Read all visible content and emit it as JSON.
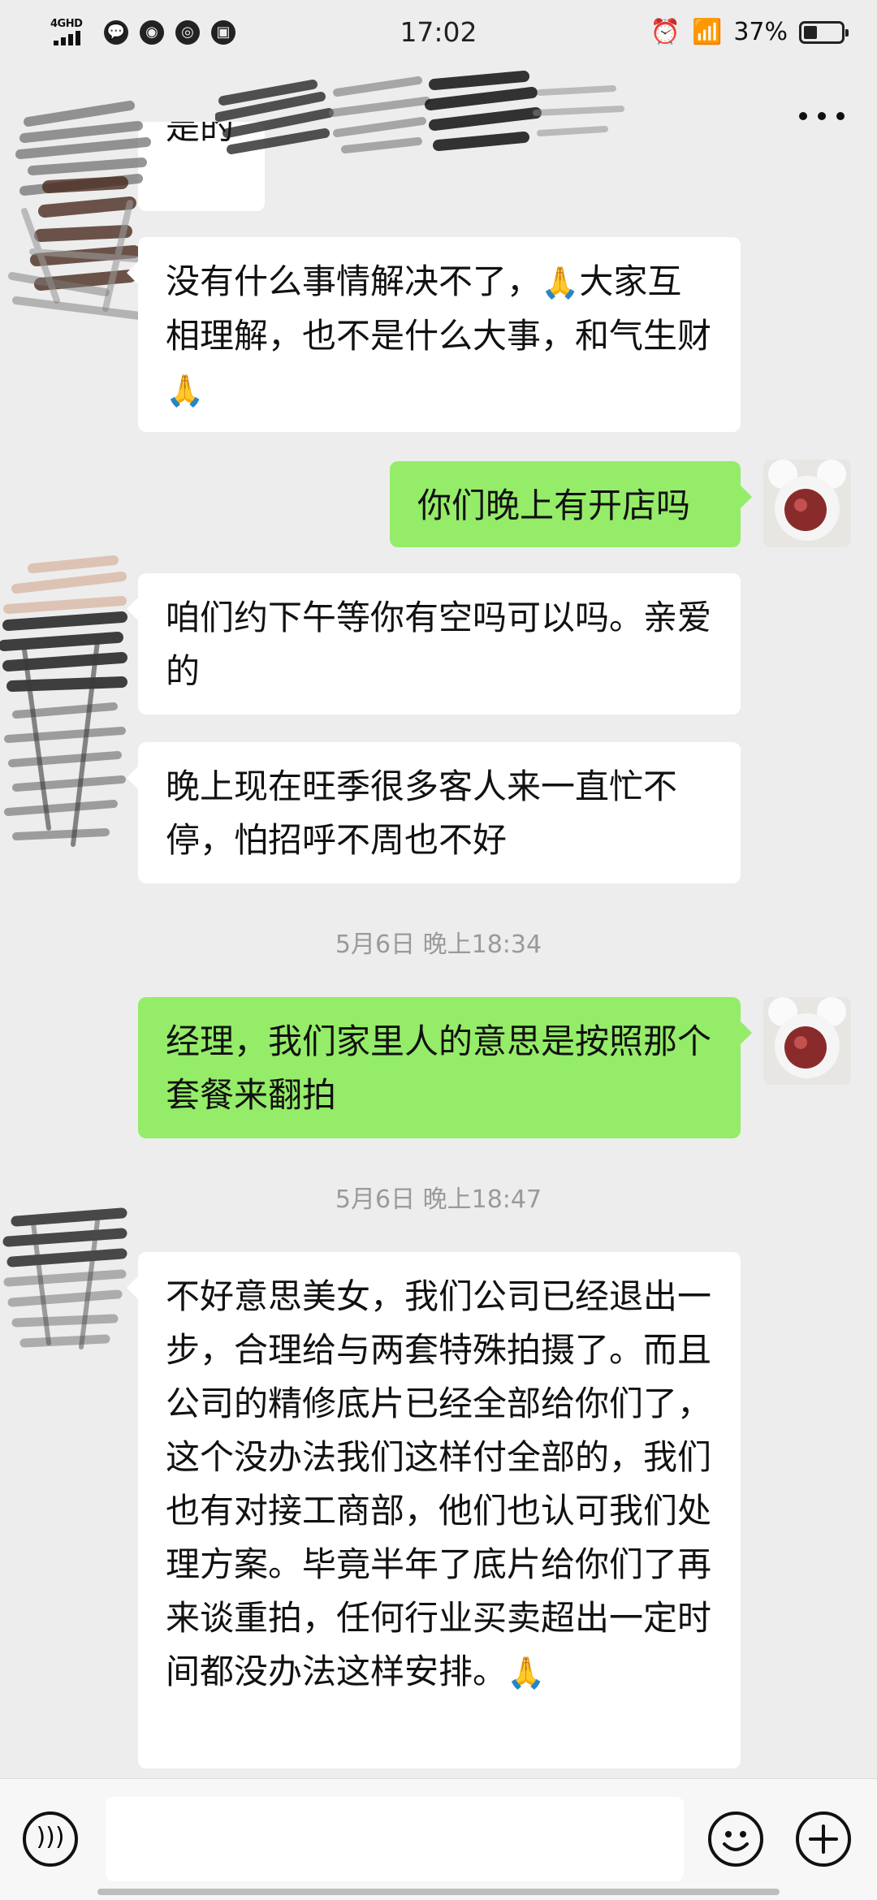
{
  "status_bar": {
    "network": "4GHD",
    "time": "17:02",
    "battery_percent": "37%",
    "battery_level": 0.37,
    "icons": [
      "chat-bubble-icon",
      "compass-icon",
      "speed-icon",
      "image-icon",
      "alarm-icon",
      "wifi-icon",
      "battery-icon"
    ]
  },
  "header": {
    "more_icon": "more-dots-icon"
  },
  "messages": [
    {
      "side": "in",
      "text": "是的"
    },
    {
      "side": "in",
      "text": "没有什么事情解决不了，",
      "emoji": "🙏",
      "text_after": "大家互相理解，也不是什么大事，和气生财",
      "emoji_end": "🙏"
    },
    {
      "side": "out",
      "text": "你们晚上有开店吗"
    },
    {
      "side": "in",
      "text": "咱们约下午等你有空吗可以吗。亲爱的"
    },
    {
      "side": "in",
      "text": "晚上现在旺季很多客人来一直忙不停，怕招呼不周也不好"
    },
    {
      "side": "time",
      "text": "5月6日 晚上18:34"
    },
    {
      "side": "out",
      "text": "经理，我们家里人的意思是按照那个套餐来翻拍"
    },
    {
      "side": "time",
      "text": "5月6日 晚上18:47"
    },
    {
      "side": "in",
      "text": "不好意思美女，我们公司已经退出一步，合理给与两套特殊拍摄了。而且公司的精修底片已经全部给你们了，这个没办法我们这样付全部的，我们也有对接工商部，他们也认可我们处理方案。毕竟半年了底片给你们了再来谈重拍，任何行业买卖超出一定时间都没办法这样安排。",
      "emoji_end": "🙏"
    }
  ],
  "input_bar": {
    "voice_icon": "voice-icon",
    "input_value": "",
    "emoji_icon": "emoji-icon",
    "plus_icon": "plus-icon"
  }
}
